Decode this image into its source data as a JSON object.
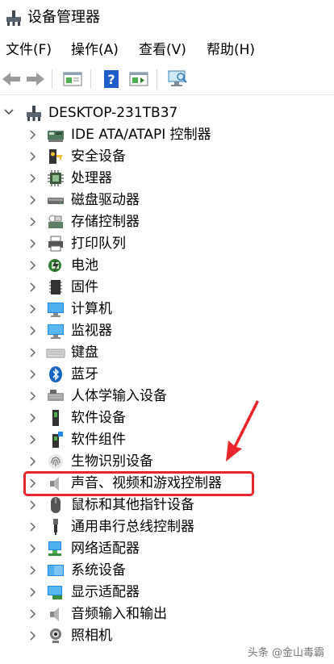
{
  "window": {
    "title": "设备管理器"
  },
  "menu": [
    "文件(F)",
    "操作(A)",
    "查看(V)",
    "帮助(H)"
  ],
  "toolbar": {
    "buttons": [
      "back-icon",
      "forward-icon",
      "properties-icon",
      "help-icon",
      "update-driver-icon",
      "scan-hardware-icon"
    ]
  },
  "tree": {
    "root": "DESKTOP-231TB37",
    "items": [
      {
        "label": "IDE ATA/ATAPI 控制器",
        "icon": "ide-controller-icon"
      },
      {
        "label": "安全设备",
        "icon": "security-device-icon"
      },
      {
        "label": "处理器",
        "icon": "processor-icon"
      },
      {
        "label": "磁盘驱动器",
        "icon": "disk-drive-icon"
      },
      {
        "label": "存储控制器",
        "icon": "storage-controller-icon"
      },
      {
        "label": "打印队列",
        "icon": "printer-icon"
      },
      {
        "label": "电池",
        "icon": "battery-icon"
      },
      {
        "label": "固件",
        "icon": "firmware-icon"
      },
      {
        "label": "计算机",
        "icon": "computer-icon"
      },
      {
        "label": "监视器",
        "icon": "monitor-icon"
      },
      {
        "label": "键盘",
        "icon": "keyboard-icon"
      },
      {
        "label": "蓝牙",
        "icon": "bluetooth-icon"
      },
      {
        "label": "人体学输入设备",
        "icon": "hid-icon"
      },
      {
        "label": "软件设备",
        "icon": "software-device-icon"
      },
      {
        "label": "软件组件",
        "icon": "software-component-icon"
      },
      {
        "label": "生物识别设备",
        "icon": "fingerprint-icon"
      },
      {
        "label": "声音、视频和游戏控制器",
        "icon": "speaker-icon"
      },
      {
        "label": "鼠标和其他指针设备",
        "icon": "mouse-icon"
      },
      {
        "label": "通用串行总线控制器",
        "icon": "usb-icon"
      },
      {
        "label": "网络适配器",
        "icon": "network-adapter-icon"
      },
      {
        "label": "系统设备",
        "icon": "system-device-icon"
      },
      {
        "label": "显示适配器",
        "icon": "display-adapter-icon"
      },
      {
        "label": "音频输入和输出",
        "icon": "audio-io-icon"
      },
      {
        "label": "照相机",
        "icon": "camera-icon"
      }
    ]
  },
  "annotation": {
    "highlight_color": "#e8262b"
  },
  "watermark": "头条 @金山毒霸"
}
